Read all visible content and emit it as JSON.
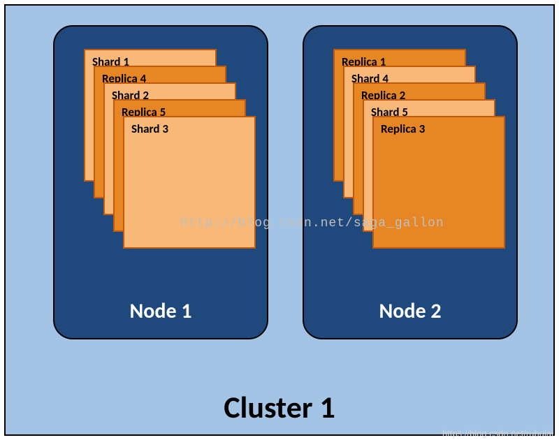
{
  "cluster": {
    "title": "Cluster 1",
    "nodes": [
      {
        "id": "node1",
        "title": "Node 1",
        "cards": [
          {
            "type": "shard",
            "label": "Shard 1"
          },
          {
            "type": "replica",
            "label": "Replica 4"
          },
          {
            "type": "shard",
            "label": "Shard 2"
          },
          {
            "type": "replica",
            "label": "Replica 5"
          },
          {
            "type": "shard",
            "label": "Shard 3"
          }
        ]
      },
      {
        "id": "node2",
        "title": "Node 2",
        "cards": [
          {
            "type": "replica",
            "label": "Replica 1"
          },
          {
            "type": "shard",
            "label": "Shard 4"
          },
          {
            "type": "replica",
            "label": "Replica 2"
          },
          {
            "type": "shard",
            "label": "Shard 5"
          },
          {
            "type": "replica",
            "label": "Replica 3"
          }
        ]
      }
    ]
  },
  "watermark": "http://blog.csdn.net/saga_gallon",
  "credit": "https://blog.csdn.net/rubulai"
}
